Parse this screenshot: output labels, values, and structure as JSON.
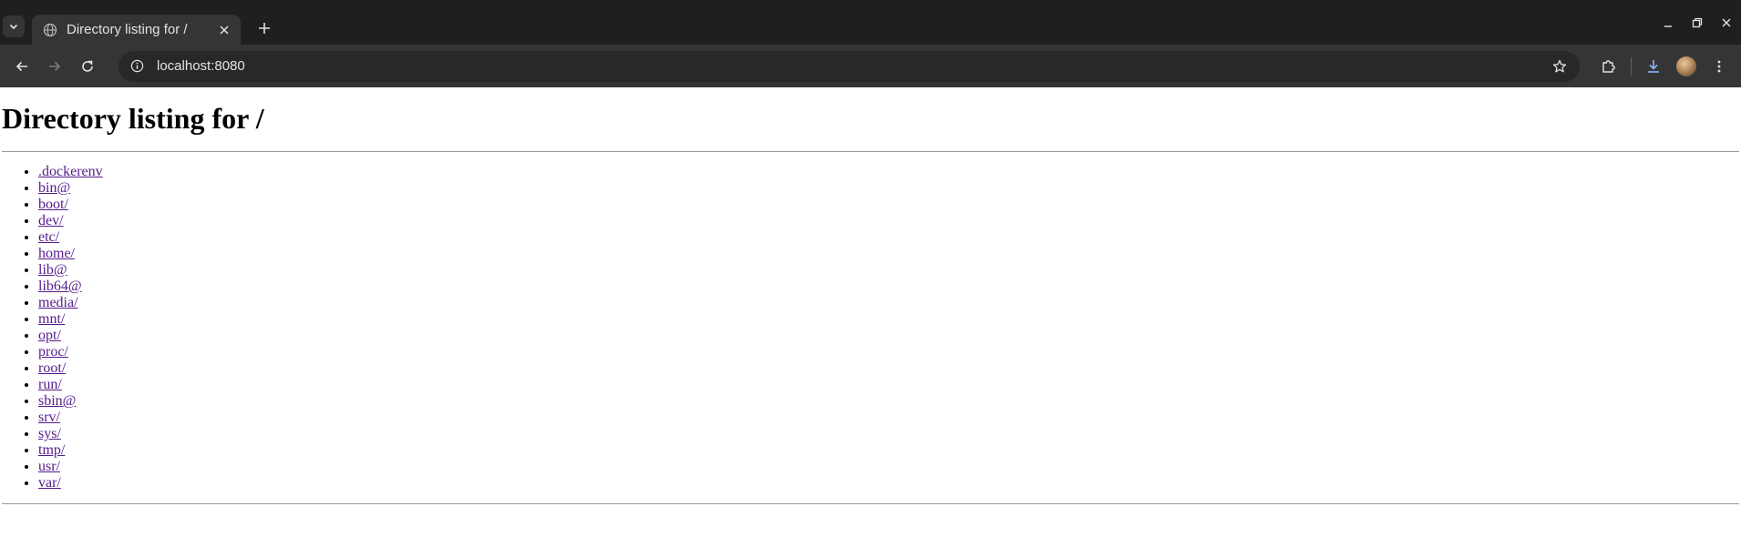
{
  "browser": {
    "tab": {
      "title": "Directory listing for /"
    },
    "address": {
      "url": "localhost:8080"
    },
    "icons": {
      "tab_search": "chevron-down-icon",
      "favicon": "globe-icon",
      "tab_close": "close-icon",
      "new_tab": "plus-icon",
      "back": "arrow-left-icon",
      "forward": "arrow-right-icon",
      "reload": "reload-icon",
      "site_info": "info-icon",
      "bookmark": "star-icon",
      "extensions": "puzzle-icon",
      "downloads": "download-icon",
      "menu": "kebab-menu-icon"
    },
    "colors": {
      "chrome_dark": "#1f1f1f",
      "toolbar": "#353535",
      "omnibox": "#282828",
      "link_visited": "#551a8b"
    }
  },
  "page": {
    "heading": "Directory listing for /",
    "entries": [
      ".dockerenv",
      "bin@",
      "boot/",
      "dev/",
      "etc/",
      "home/",
      "lib@",
      "lib64@",
      "media/",
      "mnt/",
      "opt/",
      "proc/",
      "root/",
      "run/",
      "sbin@",
      "srv/",
      "sys/",
      "tmp/",
      "usr/",
      "var/"
    ]
  }
}
